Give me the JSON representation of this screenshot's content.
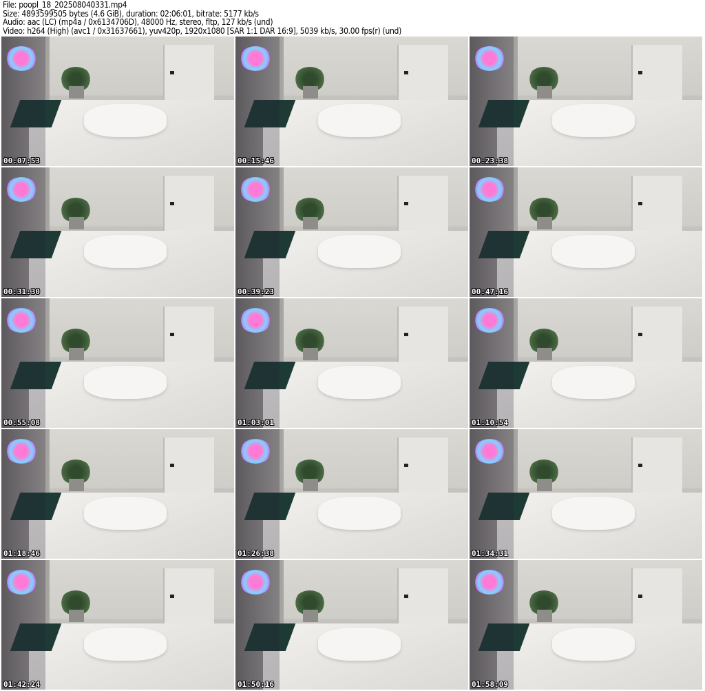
{
  "header": {
    "file": "File: poopl_18_202508040331.mp4",
    "size": "Size: 4893599505 bytes (4.6 GiB), duration: 02:06:01, bitrate: 5177 kb/s",
    "audio": "Audio: aac (LC) (mp4a / 0x6134706D), 48000 Hz, stereo, fltp, 127 kb/s (und)",
    "video": "Video: h264 (High) (avc1 / 0x31637661), yuv420p, 1920x1080 [SAR 1:1 DAR 16:9], 5039 kb/s, 30.00 fps(r) (und)"
  },
  "thumbnails": [
    {
      "timestamp": "00:07:53"
    },
    {
      "timestamp": "00:15:46"
    },
    {
      "timestamp": "00:23:38"
    },
    {
      "timestamp": "00:31:30"
    },
    {
      "timestamp": "00:39:23"
    },
    {
      "timestamp": "00:47:16"
    },
    {
      "timestamp": "00:55:08"
    },
    {
      "timestamp": "01:03:01"
    },
    {
      "timestamp": "01:10:54"
    },
    {
      "timestamp": "01:18:46"
    },
    {
      "timestamp": "01:26:38"
    },
    {
      "timestamp": "01:34:31"
    },
    {
      "timestamp": "01:42:24"
    },
    {
      "timestamp": "01:50:16"
    },
    {
      "timestamp": "01:58:09"
    }
  ]
}
